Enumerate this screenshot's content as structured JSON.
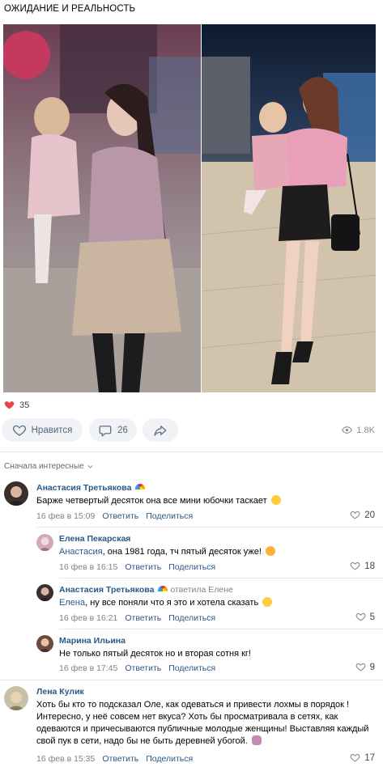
{
  "post": {
    "title": "ОЖИДАНИЕ И РЕАЛЬНОСТЬ",
    "likes": "35",
    "like_label": "Нравится",
    "comments_count": "26",
    "views": "1.8K",
    "colors": {
      "accent": "#2a5885",
      "like_red": "#e64646",
      "pill_bg": "#f0f2f5"
    }
  },
  "comments_sort": "Сначала интересные",
  "comments": [
    {
      "author": "Анастасия Третьякова",
      "text": "Барже четвертый десяток она все мини юбочки таскает",
      "date": "16 фев в 15:09",
      "reply": "Ответить",
      "share": "Поделиться",
      "likes": "20"
    },
    {
      "author": "Елена Пекарская",
      "mention": "Анастасия",
      "text": ", она 1981 года, тч пятый десяток уже!",
      "date": "16 фев в 16:15",
      "reply": "Ответить",
      "share": "Поделиться",
      "likes": "18"
    },
    {
      "author": "Анастасия Третьякова",
      "reply_to": "ответила Елене",
      "mention": "Елена",
      "text": ", ну все поняли что я это и хотела сказать",
      "date": "16 фев в 16:21",
      "reply": "Ответить",
      "share": "Поделиться",
      "likes": "5"
    },
    {
      "author": "Марина Ильина",
      "text": "Не только пятый десяток но и вторая сотня кг!",
      "date": "16 фев в 17:45",
      "reply": "Ответить",
      "share": "Поделиться",
      "likes": "9"
    },
    {
      "author": "Лена Кулик",
      "text": "Хоть бы кто то подсказал Оле, как одеваться и привести лохмы в порядок ! Интересно, у неё совсем нет вкуса? Хоть бы просматривала в сетях, как одеваются и причесываются публичные молодые женщины! Выставляя каждый свой пук в сети, надо бы не быть деревней убогой.",
      "date": "16 фев в 15:35",
      "reply": "Ответить",
      "share": "Поделиться",
      "likes": "17"
    }
  ]
}
